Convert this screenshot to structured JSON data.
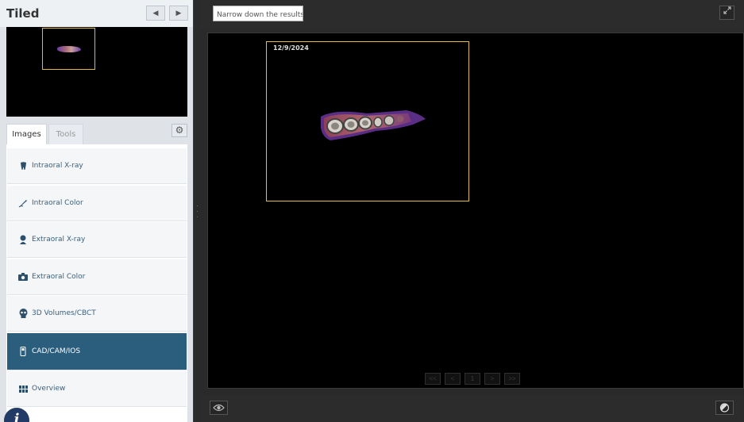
{
  "panel": {
    "title": "Tiled",
    "prev_icon": "triangle-left-icon",
    "next_icon": "triangle-right-icon"
  },
  "tabs": [
    {
      "label": "Images",
      "active": true
    },
    {
      "label": "Tools",
      "active": false
    }
  ],
  "categories": [
    {
      "label": "Intraoral X-ray",
      "icon": "tooth-icon",
      "active": false
    },
    {
      "label": "Intraoral Color",
      "icon": "brush-icon",
      "active": false
    },
    {
      "label": "Extraoral X-ray",
      "icon": "person-icon",
      "active": false
    },
    {
      "label": "Extraoral Color",
      "icon": "camera-icon",
      "active": false
    },
    {
      "label": "3D Volumes/CBCT",
      "icon": "skull-icon",
      "active": false
    },
    {
      "label": "CAD/CAM/IOS",
      "icon": "scanner-icon",
      "active": true
    },
    {
      "label": "Overview",
      "icon": "grid-icon",
      "active": false
    }
  ],
  "search": {
    "placeholder": "Narrow down the results"
  },
  "tile": {
    "date": "12/9/2024"
  },
  "pager": {
    "buttons": [
      "<<",
      "<",
      "1",
      ">",
      ">>"
    ],
    "current_page": "1"
  },
  "colors": {
    "active_item": "#2b5e7c",
    "tile_border": "#e1c042",
    "viewer_bg": "#000000"
  }
}
